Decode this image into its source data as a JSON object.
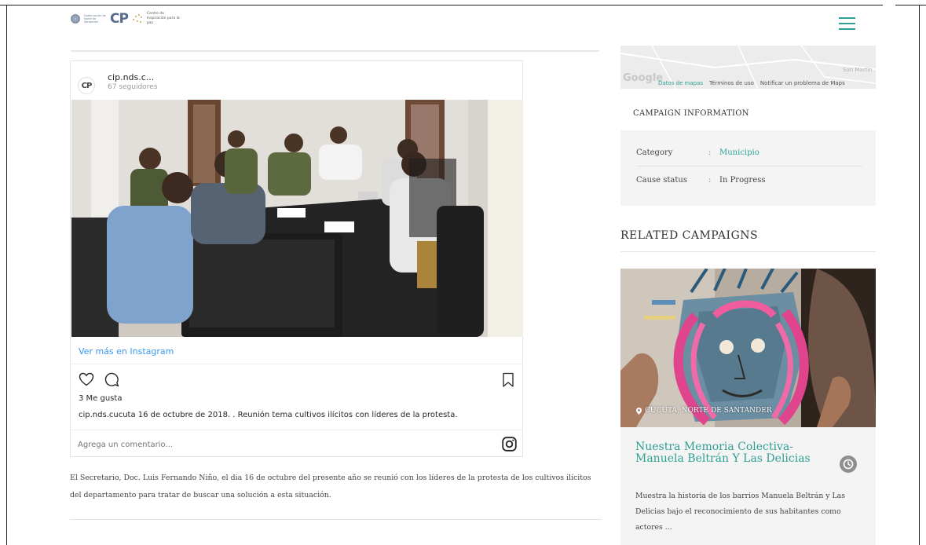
{
  "header": {
    "logo_small_text": "Gobernación de Norte de Santander",
    "logo_cp": "CP",
    "logo_tagline": "Centro de Inspiración para la paz",
    "menu_icon": "hamburger-menu-icon"
  },
  "instagram": {
    "avatar_text": "CP",
    "username": "cip.nds.c...",
    "followers": "67 seguidores",
    "view_more": "Ver más en Instagram",
    "likes": "3 Me gusta",
    "caption": "cip.nds.cucuta 16 de octubre de 2018. . Reunión tema cultivos ilícitos con líderes de la protesta.",
    "comment_placeholder": "Agrega un comentario...",
    "icons": [
      "heart-icon",
      "comment-icon",
      "bookmark-icon",
      "instagram-logo-icon"
    ]
  },
  "article": {
    "description": "El Secretario, Doc. Luis Fernando Niño, el dia 16 de octubre del presente año se reunió con los líderes de la protesta de los cultivos ilícitos del departamento para tratar de buscar una solución a esta situación."
  },
  "map": {
    "google": "Google",
    "place": "San Martín",
    "links": [
      "Datos de mapas",
      "Términos de uso",
      "Notificar un problema de Maps"
    ]
  },
  "campaign_info": {
    "title": "CAMPAIGN INFORMATION",
    "rows": [
      {
        "label": "Category",
        "separator": ":",
        "value": "Municipio"
      },
      {
        "label": "Cause status",
        "separator": ":",
        "value": "In Progress"
      }
    ]
  },
  "related": {
    "title": "RELATED CAMPAIGNS",
    "card": {
      "location": "CÚCUTA, NORTE DE SANTANDER",
      "title": "Nuestra Memoria Colectiva- Manuela Beltrán Y Las Delicias",
      "description": "Muestra la historia de los barrios Manuela Beltrán y Las Delicias bajo el reconocimiento de sus habitantes como actores ..."
    }
  },
  "colors": {
    "accent": "#2ea095",
    "link_blue": "#3897f0",
    "panel_bg": "#f4f4f4"
  }
}
